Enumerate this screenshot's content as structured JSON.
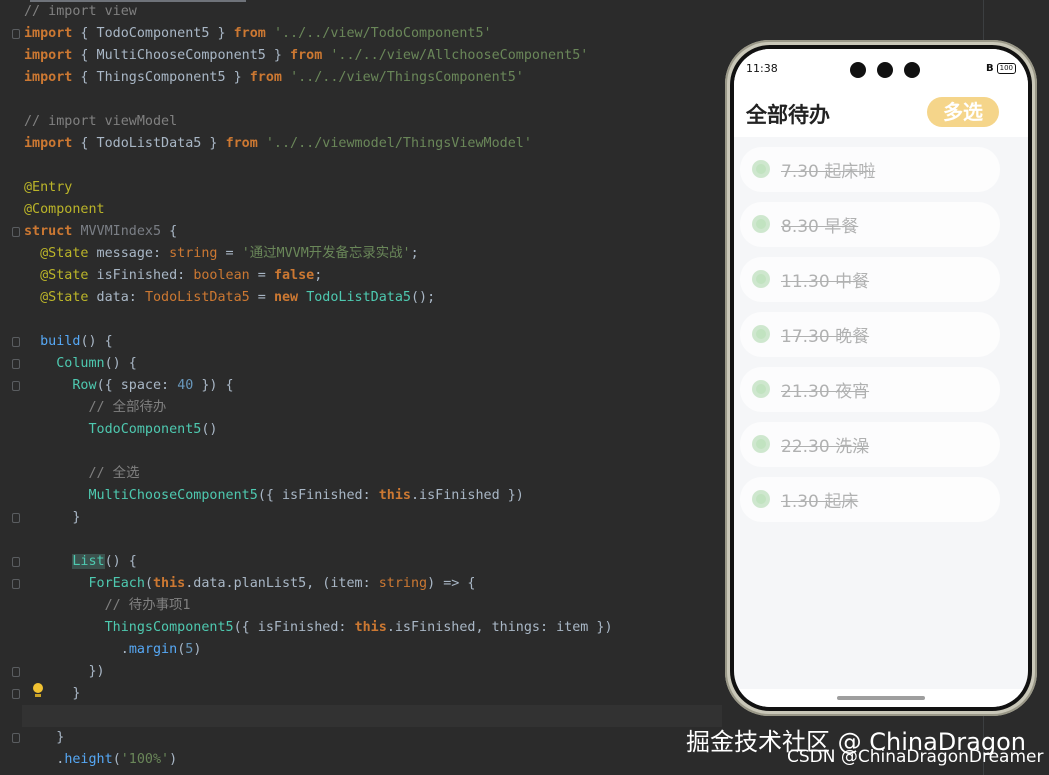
{
  "editor": {
    "lines": [
      [
        {
          "t": "// import view",
          "c": "c-comment"
        }
      ],
      [
        {
          "t": "import",
          "c": "c-kw"
        },
        {
          "t": " { TodoComponent5 } ",
          "c": "c-plain"
        },
        {
          "t": "from",
          "c": "c-kw"
        },
        {
          "t": " ",
          "c": "c-plain"
        },
        {
          "t": "'../../view/TodoComponent5'",
          "c": "c-str"
        }
      ],
      [
        {
          "t": "import",
          "c": "c-kw"
        },
        {
          "t": " { MultiChooseComponent5 } ",
          "c": "c-plain"
        },
        {
          "t": "from",
          "c": "c-kw"
        },
        {
          "t": " ",
          "c": "c-plain"
        },
        {
          "t": "'../../view/AllchooseComponent5'",
          "c": "c-str"
        }
      ],
      [
        {
          "t": "import",
          "c": "c-kw"
        },
        {
          "t": " { ThingsComponent5 } ",
          "c": "c-plain"
        },
        {
          "t": "from",
          "c": "c-kw"
        },
        {
          "t": " ",
          "c": "c-plain"
        },
        {
          "t": "'../../view/ThingsComponent5'",
          "c": "c-str"
        }
      ],
      [],
      [
        {
          "t": "// import viewModel",
          "c": "c-comment"
        }
      ],
      [
        {
          "t": "import",
          "c": "c-kw"
        },
        {
          "t": " { TodoListData5 } ",
          "c": "c-plain"
        },
        {
          "t": "from",
          "c": "c-kw"
        },
        {
          "t": " ",
          "c": "c-plain"
        },
        {
          "t": "'../../viewmodel/ThingsViewModel'",
          "c": "c-str"
        }
      ],
      [],
      [
        {
          "t": "@Entry",
          "c": "c-ann"
        }
      ],
      [
        {
          "t": "@Component",
          "c": "c-ann"
        }
      ],
      [
        {
          "t": "struct",
          "c": "c-kw"
        },
        {
          "t": " ",
          "c": "c-plain"
        },
        {
          "t": "MVVMIndex5",
          "c": "c-gray"
        },
        {
          "t": " {",
          "c": "c-plain"
        }
      ],
      [
        {
          "t": "  ",
          "c": "c-plain"
        },
        {
          "t": "@State",
          "c": "c-ann"
        },
        {
          "t": " message: ",
          "c": "c-plain"
        },
        {
          "t": "string",
          "c": "c-type"
        },
        {
          "t": " = ",
          "c": "c-plain"
        },
        {
          "t": "'通过MVVM开发备忘录实战'",
          "c": "c-str"
        },
        {
          "t": ";",
          "c": "c-plain"
        }
      ],
      [
        {
          "t": "  ",
          "c": "c-plain"
        },
        {
          "t": "@State",
          "c": "c-ann"
        },
        {
          "t": " isFinished: ",
          "c": "c-plain"
        },
        {
          "t": "boolean",
          "c": "c-type"
        },
        {
          "t": " = ",
          "c": "c-plain"
        },
        {
          "t": "false",
          "c": "c-kw"
        },
        {
          "t": ";",
          "c": "c-plain"
        }
      ],
      [
        {
          "t": "  ",
          "c": "c-plain"
        },
        {
          "t": "@State",
          "c": "c-ann"
        },
        {
          "t": " data: ",
          "c": "c-plain"
        },
        {
          "t": "TodoListData5",
          "c": "c-type"
        },
        {
          "t": " = ",
          "c": "c-plain"
        },
        {
          "t": "new",
          "c": "c-kw"
        },
        {
          "t": " ",
          "c": "c-plain"
        },
        {
          "t": "TodoListData5",
          "c": "c-cls"
        },
        {
          "t": "();",
          "c": "c-plain"
        }
      ],
      [],
      [
        {
          "t": "  ",
          "c": "c-plain"
        },
        {
          "t": "build",
          "c": "c-func"
        },
        {
          "t": "() {",
          "c": "c-plain"
        }
      ],
      [
        {
          "t": "    ",
          "c": "c-plain"
        },
        {
          "t": "Column",
          "c": "c-cls"
        },
        {
          "t": "() {",
          "c": "c-plain"
        }
      ],
      [
        {
          "t": "      ",
          "c": "c-plain"
        },
        {
          "t": "Row",
          "c": "c-cls"
        },
        {
          "t": "({ space: ",
          "c": "c-plain"
        },
        {
          "t": "40",
          "c": "c-num"
        },
        {
          "t": " }) {",
          "c": "c-plain"
        }
      ],
      [
        {
          "t": "        ",
          "c": "c-plain"
        },
        {
          "t": "// 全部待办",
          "c": "c-comment"
        }
      ],
      [
        {
          "t": "        ",
          "c": "c-plain"
        },
        {
          "t": "TodoComponent5",
          "c": "c-cls"
        },
        {
          "t": "()",
          "c": "c-plain"
        }
      ],
      [],
      [
        {
          "t": "        ",
          "c": "c-plain"
        },
        {
          "t": "// 全选",
          "c": "c-comment"
        }
      ],
      [
        {
          "t": "        ",
          "c": "c-plain"
        },
        {
          "t": "MultiChooseComponent5",
          "c": "c-cls"
        },
        {
          "t": "({ isFinished: ",
          "c": "c-plain"
        },
        {
          "t": "this",
          "c": "c-kw"
        },
        {
          "t": ".isFinished })",
          "c": "c-plain"
        }
      ],
      [
        {
          "t": "      }",
          "c": "c-plain"
        }
      ],
      [],
      [
        {
          "t": "      ",
          "c": "c-plain"
        },
        {
          "t": "List",
          "c": "c-cls hl"
        },
        {
          "t": "() {",
          "c": "c-plain"
        }
      ],
      [
        {
          "t": "        ",
          "c": "c-plain"
        },
        {
          "t": "ForEach",
          "c": "c-cls"
        },
        {
          "t": "(",
          "c": "c-plain"
        },
        {
          "t": "this",
          "c": "c-kw"
        },
        {
          "t": ".data.planList5, (item: ",
          "c": "c-plain"
        },
        {
          "t": "string",
          "c": "c-type"
        },
        {
          "t": ") => {",
          "c": "c-plain"
        }
      ],
      [
        {
          "t": "          ",
          "c": "c-plain"
        },
        {
          "t": "// 待办事项1",
          "c": "c-comment"
        }
      ],
      [
        {
          "t": "          ",
          "c": "c-plain"
        },
        {
          "t": "ThingsComponent5",
          "c": "c-cls"
        },
        {
          "t": "({ isFinished: ",
          "c": "c-plain"
        },
        {
          "t": "this",
          "c": "c-kw"
        },
        {
          "t": ".isFinished, things: item })",
          "c": "c-plain"
        }
      ],
      [
        {
          "t": "            .",
          "c": "c-plain"
        },
        {
          "t": "margin",
          "c": "c-func"
        },
        {
          "t": "(",
          "c": "c-plain"
        },
        {
          "t": "5",
          "c": "c-num"
        },
        {
          "t": ")",
          "c": "c-plain"
        }
      ],
      [
        {
          "t": "        })",
          "c": "c-plain"
        }
      ],
      [
        {
          "t": "      }",
          "c": "c-plain"
        }
      ],
      [],
      [
        {
          "t": "    }",
          "c": "c-plain"
        }
      ],
      [
        {
          "t": "    .",
          "c": "c-plain"
        },
        {
          "t": "height",
          "c": "c-func"
        },
        {
          "t": "(",
          "c": "c-plain"
        },
        {
          "t": "'100%'",
          "c": "c-str"
        },
        {
          "t": ")",
          "c": "c-plain"
        }
      ]
    ]
  },
  "phone": {
    "time": "11:38",
    "battery": "100",
    "title": "全部待办",
    "multi_select_label": "多选",
    "todo_items": [
      "7.30 起床啦",
      "8.30 早餐",
      "11.30 中餐",
      "17.30 晚餐",
      "21.30 夜宵",
      "22.30 洗澡",
      "1.30 起床"
    ],
    "radio_color": "#8fcf8c",
    "button_color": "#f5d58a"
  },
  "watermark": {
    "line1": "掘金技术社区 @ ChinaDragon",
    "line2": "CSDN @ChinaDragonDreamer"
  }
}
